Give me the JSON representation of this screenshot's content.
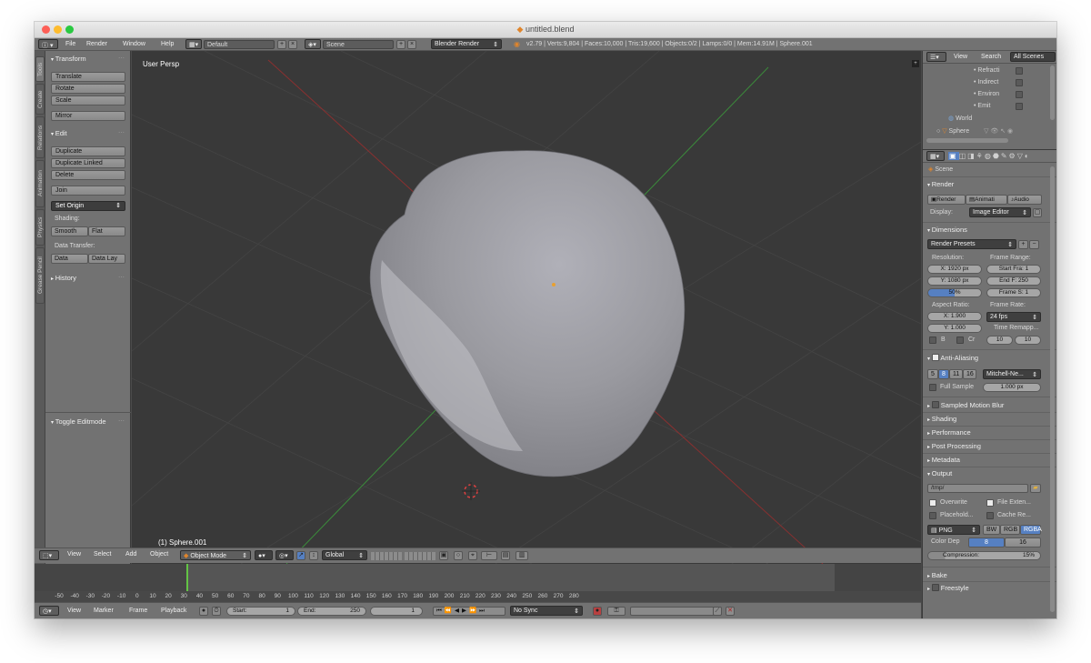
{
  "window": {
    "title": "untitled.blend"
  },
  "menu": {
    "items": [
      "File",
      "Render",
      "Window",
      "Help"
    ]
  },
  "screen_layout": "Default",
  "scene": "Scene",
  "engine": "Blender Render",
  "stats": "v2.79 | Verts:9,804 | Faces:10,000 | Tris:19,600 | Objects:0/2 | Lamps:0/0 | Mem:14.91M | Sphere.001",
  "toolshelf": {
    "tabs": [
      "Tools",
      "Create",
      "Relations",
      "Animation",
      "Physics",
      "Grease Pencil"
    ],
    "transform": {
      "header": "Transform",
      "buttons": [
        "Translate",
        "Rotate",
        "Scale",
        "Mirror"
      ]
    },
    "edit": {
      "header": "Edit",
      "buttons": [
        "Duplicate",
        "Duplicate Linked",
        "Delete",
        "Join"
      ],
      "set_origin": "Set Origin"
    },
    "shading": {
      "label": "Shading:",
      "smooth": "Smooth",
      "flat": "Flat"
    },
    "data_transfer": {
      "label": "Data Transfer:",
      "data": "Data",
      "data_lay": "Data Lay"
    },
    "history": "History",
    "toggle_editmode": "Toggle Editmode"
  },
  "viewport": {
    "title": "User Persp",
    "object_name": "(1) Sphere.001"
  },
  "viewport_header": {
    "menus": [
      "View",
      "Select",
      "Add",
      "Object"
    ],
    "mode": "Object Mode",
    "orientation": "Global"
  },
  "timeline": {
    "ticks": [
      "-50",
      "-40",
      "-30",
      "-20",
      "-10",
      "0",
      "10",
      "20",
      "30",
      "40",
      "50",
      "60",
      "70",
      "80",
      "90",
      "100",
      "110",
      "120",
      "130",
      "140",
      "150",
      "160",
      "170",
      "180",
      "190",
      "200",
      "210",
      "220",
      "230",
      "240",
      "250",
      "260",
      "270",
      "280"
    ],
    "current_frame": 0,
    "menus": [
      "View",
      "Marker",
      "Frame",
      "Playback"
    ],
    "start_label": "Start:",
    "start": "1",
    "end_label": "End:",
    "end": "250",
    "frame": "1",
    "sync": "No Sync"
  },
  "outliner": {
    "tabs": [
      "View",
      "Search",
      "All Scenes"
    ],
    "items": [
      "Refracti",
      "Indirect",
      "Environ",
      "Emit",
      "World",
      "Sphere"
    ]
  },
  "properties": {
    "breadcrumb": "Scene",
    "render": {
      "header": "Render",
      "buttons": [
        "Render",
        "Animati",
        "Audio"
      ],
      "display_label": "Display:",
      "display": "Image Editor"
    },
    "dimensions": {
      "header": "Dimensions",
      "presets": "Render Presets",
      "resolution_label": "Resolution:",
      "res_x": "X: 1920 px",
      "res_y": "Y: 1080 px",
      "res_pct": "50%",
      "frame_range_label": "Frame Range:",
      "start_frame": "Start Fra: 1",
      "end_frame": "End F: 250",
      "frame_step": "Frame S: 1",
      "aspect_label": "Aspect Ratio:",
      "aspect_x": "X: 1.900",
      "aspect_y": "Y: 1.000",
      "frame_rate_label": "Frame Rate:",
      "fps": "24 fps",
      "time_remap": "Time Remapp...",
      "remap_old": "10",
      "remap_new": "10",
      "b_label": "B",
      "cr_label": "Cr"
    },
    "anti_aliasing": {
      "header": "Anti-Aliasing",
      "samples": [
        "5",
        "8",
        "11",
        "16"
      ],
      "filter": "Mitchell-Ne...",
      "full_sample": "Full Sample",
      "size": "1.000 px"
    },
    "sampled_motion_blur": "Sampled Motion Blur",
    "collapsed_panels": [
      "Shading",
      "Performance",
      "Post Processing",
      "Metadata"
    ],
    "output": {
      "header": "Output",
      "path": "/tmp/",
      "overwrite": "Overwrite",
      "file_ext": "File Exten...",
      "placeholders": "Placehold...",
      "cache_result": "Cache Re...",
      "format": "PNG",
      "color_modes": [
        "BW",
        "RGB",
        "RGBA"
      ],
      "color_depth_label": "Color Dep",
      "depths": [
        "8",
        "16"
      ],
      "compression_label": "Compression:",
      "compression_value": "15%"
    },
    "bake": "Bake",
    "freestyle": "Freestyle"
  },
  "colors": {
    "accent": "#5680c2",
    "background": "#393939",
    "panel": "#727272",
    "mesh": "#9c9ca2",
    "timeline_cursor": "#63c445"
  }
}
